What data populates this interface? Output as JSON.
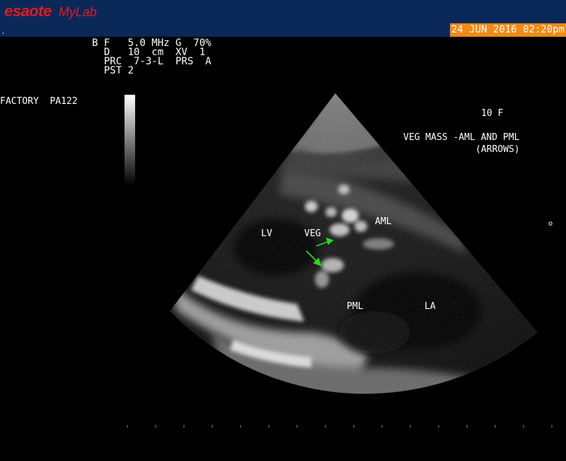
{
  "header": {
    "brand": "esaote",
    "product": "MyLab",
    "indicator": "‚",
    "datetime": "24 JUN 2016 02:20pm"
  },
  "parameters": {
    "line1": "B F   5.0 MHz G  70%",
    "line2": "  D   10  cm  XV  1",
    "line3": "  PRC  7-3-L  PRS  A",
    "line4": "  PST 2"
  },
  "preset": "FACTORY  PA122",
  "annotations": {
    "age": "10 F",
    "caption_line1": "VEG MASS -AML AND PML",
    "caption_line2": "(ARROWS)",
    "lv": "LV",
    "veg": "VEG",
    "aml": "AML",
    "pml": "PML",
    "la": "LA"
  },
  "depth_marker": "o",
  "colors": {
    "header_bg": "#0a2857",
    "brand_red": "#e11b22",
    "datetime_bg": "#f28a16",
    "arrow_green": "#22dd22"
  },
  "icons": {
    "arrow_1": "green-arrow-icon",
    "arrow_2": "green-arrow-icon"
  }
}
